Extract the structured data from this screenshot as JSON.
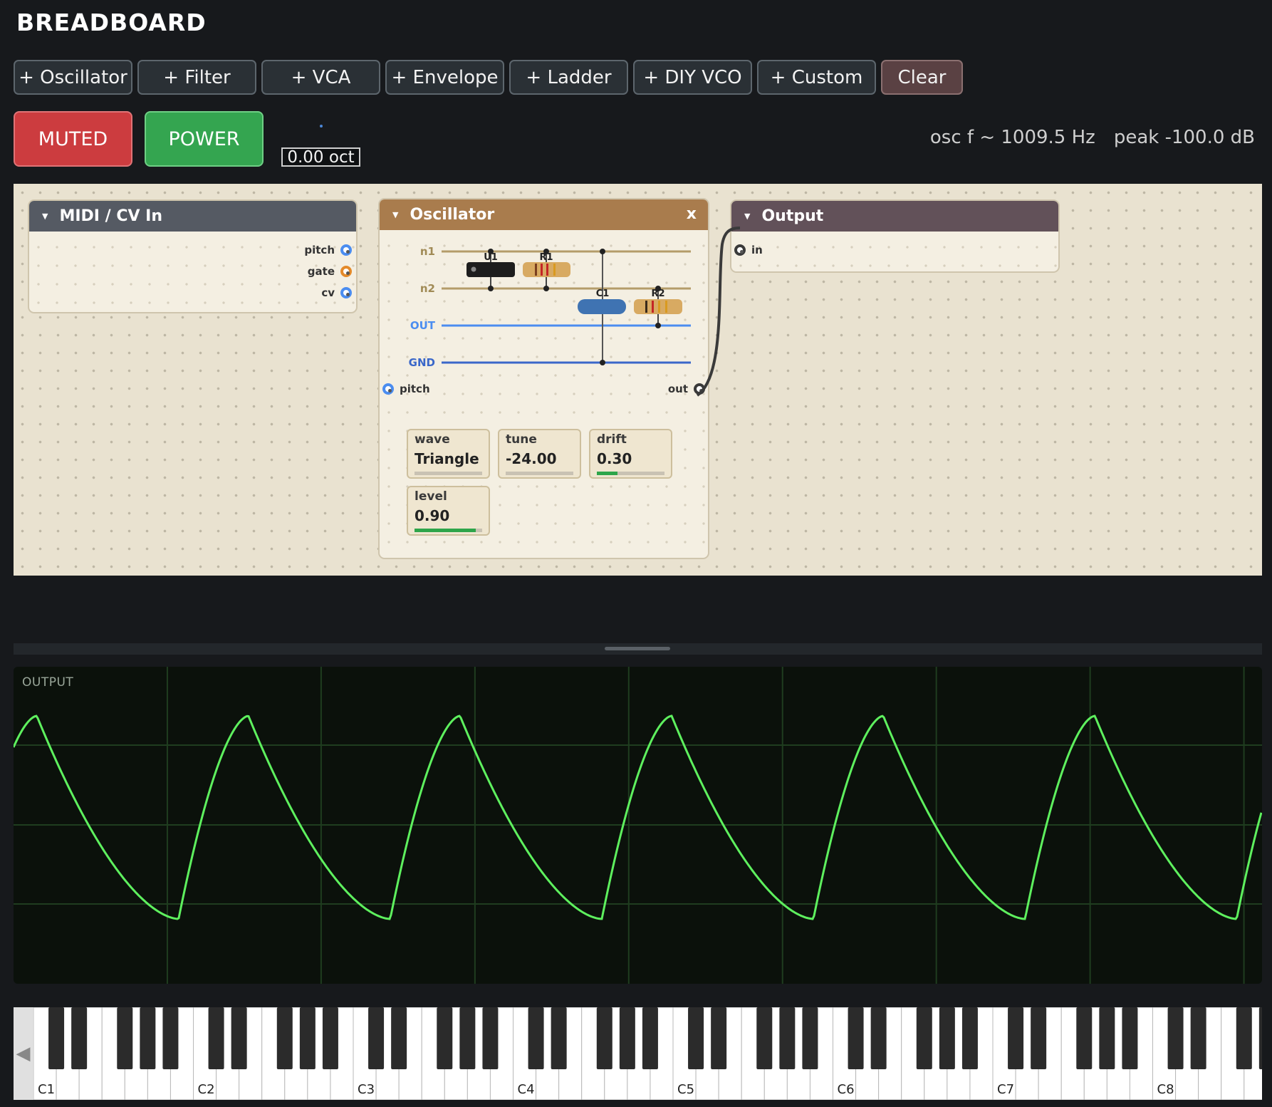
{
  "app": {
    "title": "BREADBOARD"
  },
  "toolbar": {
    "buttons": [
      "+ Oscillator",
      "+ Filter",
      "+ VCA",
      "+ Envelope",
      "+ Ladder",
      "+ DIY VCO",
      "+ Custom"
    ],
    "clear_label": "Clear"
  },
  "controls": {
    "muted_label": "MUTED",
    "power_label": "POWER",
    "octave_value": "0.00 oct"
  },
  "status": {
    "osc_freq": "osc f ~ 1009.5 Hz",
    "peak": "peak -100.0 dB"
  },
  "colors": {
    "muted": "#cc3c3f",
    "power": "#34a550",
    "midi_header": "#555a63",
    "osc_header": "#a97c4d",
    "output_header": "#625159",
    "trace": "#5ef05e",
    "port_blue": "#4b8df0",
    "port_orange": "#e48a2a"
  },
  "modules": {
    "midi": {
      "title": "MIDI / CV In",
      "ports": [
        "pitch",
        "gate",
        "cv"
      ]
    },
    "oscillator": {
      "title": "Oscillator",
      "close_label": "x",
      "rails": [
        "n1",
        "n2",
        "OUT",
        "GND"
      ],
      "components": [
        "U1",
        "R1",
        "C1",
        "R2"
      ],
      "input_port": "pitch",
      "output_port": "out",
      "params": [
        {
          "label": "wave",
          "value": "Triangle",
          "level": 0
        },
        {
          "label": "tune",
          "value": "-24.00",
          "level": 0
        },
        {
          "label": "drift",
          "value": "0.30",
          "level": 0.3
        },
        {
          "label": "level",
          "value": "0.90",
          "level": 0.9
        }
      ]
    },
    "output": {
      "title": "Output",
      "input_port": "in"
    }
  },
  "scope": {
    "label": "OUTPUT",
    "waveform": "triangle",
    "cycles_visible": 5.9
  },
  "keyboard": {
    "octave_labels": [
      "C1",
      "C2",
      "C3",
      "C4",
      "C5",
      "C6",
      "C7",
      "C8"
    ],
    "scroll_left_icon": "triangle-left-icon"
  }
}
